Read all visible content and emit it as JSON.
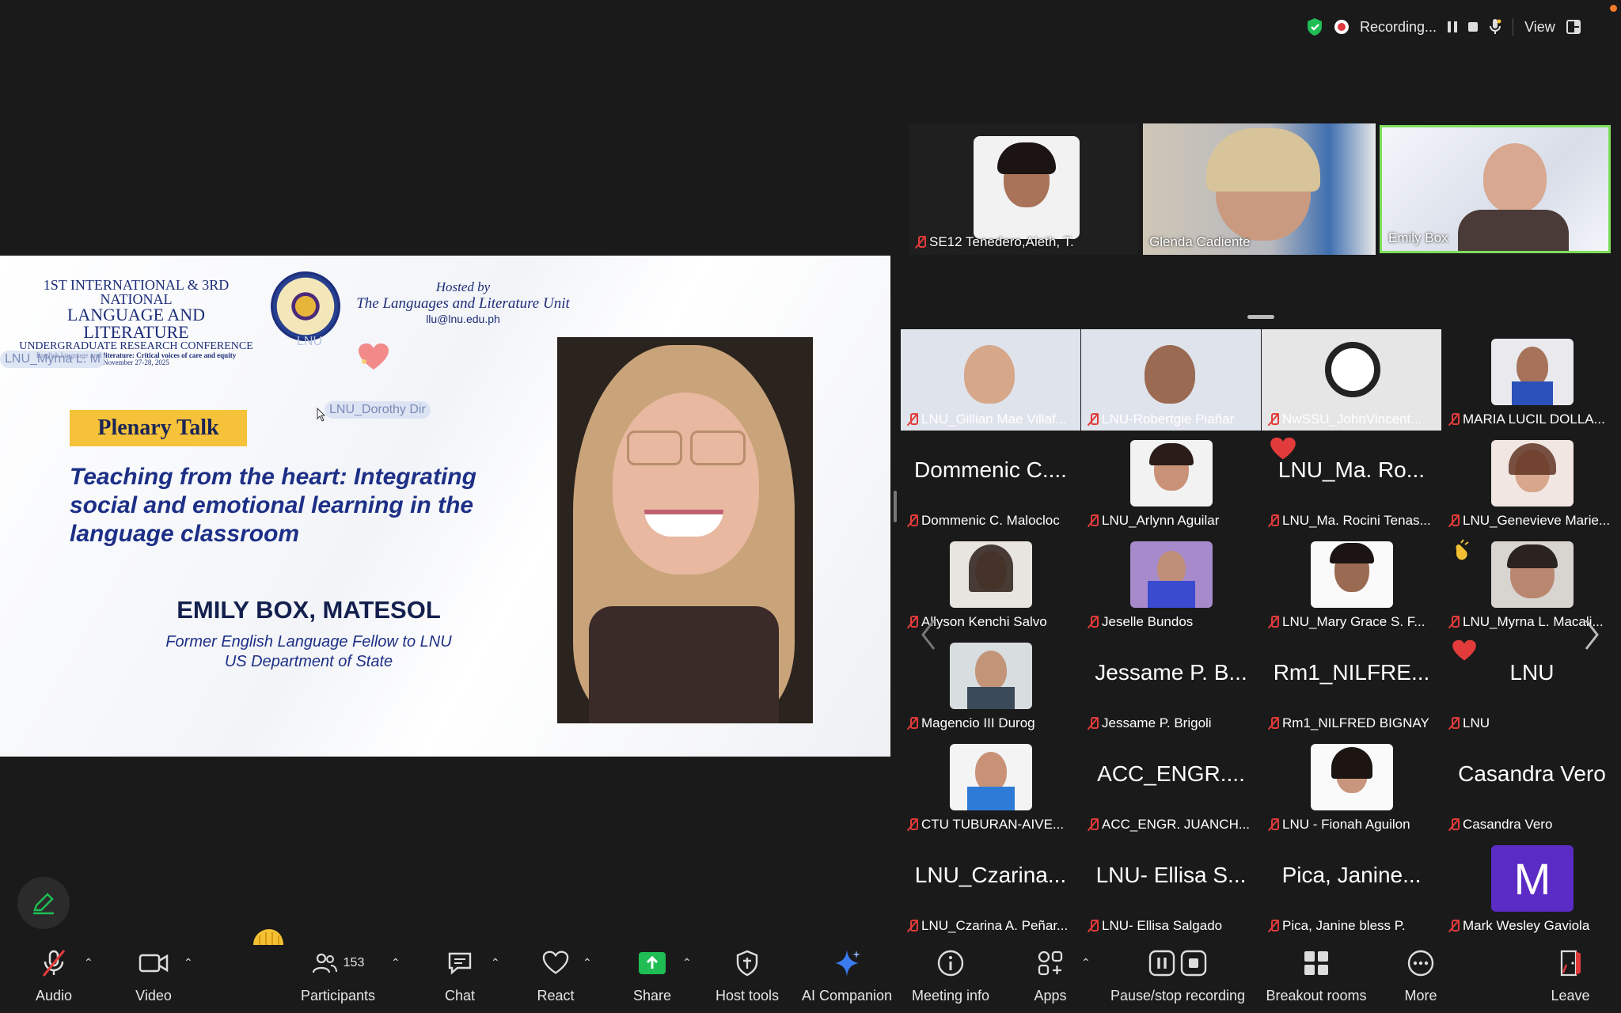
{
  "status_bar": {
    "recording_label": "Recording...",
    "view_label": "View"
  },
  "slide": {
    "conference_line1": "1ST INTERNATIONAL & 3RD NATIONAL",
    "conference_line2": "LANGUAGE AND LITERATURE",
    "conference_line3": "UNDERGRADUATE RESEARCH CONFERENCE",
    "conference_line4": "English language and literature: Critical voices of care and equity",
    "conference_date": "November 27-28, 2025",
    "hosted_by": "Hosted by",
    "host_unit": "The Languages and Literature Unit",
    "host_email": "llu@lnu.edu.ph",
    "ghost_name_1": "LNU_Myrna L. M",
    "ghost_name_2": "LNU_Dorothy Dir",
    "ghost_name_3": "LNU",
    "plenary_label": "Plenary Talk",
    "talk_title": "Teaching from the heart: Integrating social and emotional learning in the language classroom",
    "speaker_name": "EMILY BOX, MATESOL",
    "speaker_role_1": "Former English Language Fellow to LNU",
    "speaker_role_2": "US Department of State"
  },
  "top_videos": [
    {
      "name": "SE12 Tenedero,Aleth, T.",
      "muted": true
    },
    {
      "name": "Glenda Cadiente",
      "muted": false
    },
    {
      "name": "Emily Box",
      "muted": false,
      "active_speaker": true
    }
  ],
  "gallery": [
    {
      "big": "",
      "label": "LNU_Gillian Mae Villaf..."
    },
    {
      "big": "",
      "label": "LNU-Robertgie Piañar"
    },
    {
      "big": "",
      "label": "NwSSU_JohnVincent..."
    },
    {
      "big": "",
      "label": "MARIA LUCIL DOLLA..."
    },
    {
      "big": "Dommenic C....",
      "label": "Dommenic C. Malocloc"
    },
    {
      "big": "",
      "label": "LNU_Arlynn Aguilar"
    },
    {
      "big": "LNU_Ma. Ro...",
      "label": "LNU_Ma. Rocini Tenas..."
    },
    {
      "big": "",
      "label": "LNU_Genevieve Marie..."
    },
    {
      "big": "",
      "label": "Allyson Kenchi Salvo"
    },
    {
      "big": "",
      "label": "Jeselle Bundos"
    },
    {
      "big": "",
      "label": "LNU_Mary Grace S. F..."
    },
    {
      "big": "",
      "label": "LNU_Myrna L. Macali..."
    },
    {
      "big": "",
      "label": "Magencio III Durog"
    },
    {
      "big": "Jessame P. B...",
      "label": "Jessame P. Brigoli"
    },
    {
      "big": "Rm1_NILFRE...",
      "label": "Rm1_NILFRED BIGNAY"
    },
    {
      "big": "LNU",
      "label": "LNU"
    },
    {
      "big": "",
      "label": "CTU TUBURAN-AIVE..."
    },
    {
      "big": "ACC_ENGR....",
      "label": "ACC_ENGR. JUANCH..."
    },
    {
      "big": "",
      "label": "LNU - Fionah Aguilon"
    },
    {
      "big": "Casandra Vero",
      "label": "Casandra Vero"
    },
    {
      "big": "LNU_Czarina...",
      "label": "LNU_Czarina A. Peñar..."
    },
    {
      "big": "LNU- Ellisa S...",
      "label": "LNU- Ellisa Salgado"
    },
    {
      "big": "Pica, Janine...",
      "label": "Pica, Janine bless P."
    },
    {
      "big": "M",
      "label": "Mark Wesley Gaviola"
    }
  ],
  "toolbar": {
    "audio": "Audio",
    "video": "Video",
    "participants": "Participants",
    "participants_count": "153",
    "chat": "Chat",
    "react": "React",
    "share": "Share",
    "host_tools": "Host tools",
    "ai_companion": "AI Companion",
    "meeting_info": "Meeting info",
    "apps": "Apps",
    "pause_stop": "Pause/stop recording",
    "breakout": "Breakout rooms",
    "more": "More",
    "leave": "Leave"
  },
  "colors": {
    "accent_green": "#1fbd54",
    "muted_red": "#e23b3b",
    "avatar_purple": "#5b2bc5",
    "speaker_border": "#7dde5a"
  }
}
